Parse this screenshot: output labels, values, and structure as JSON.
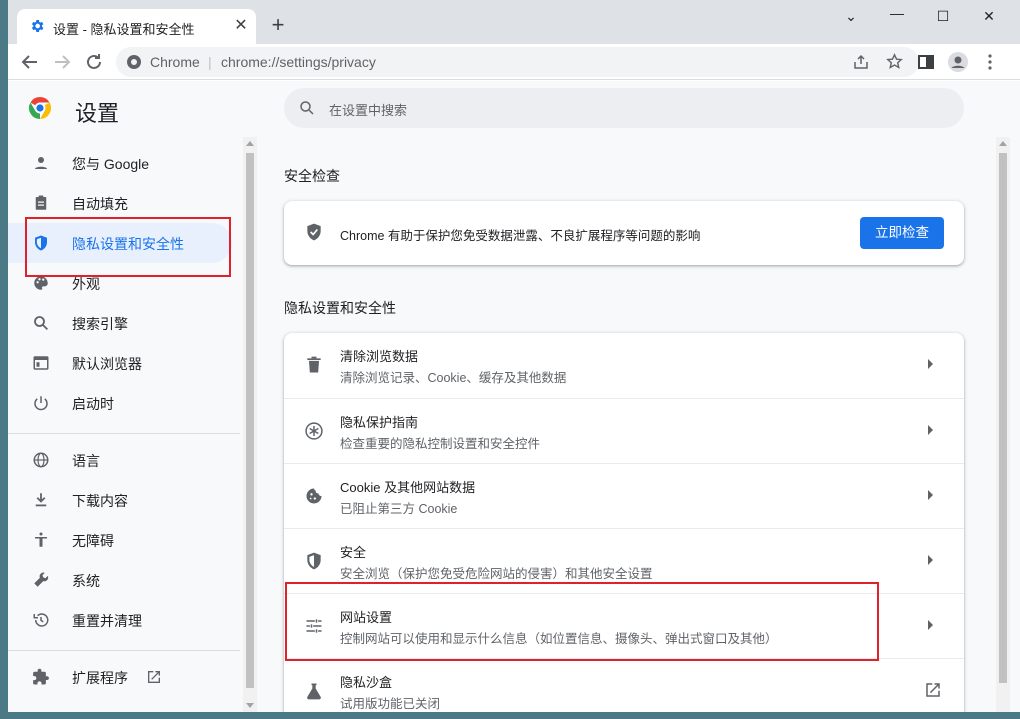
{
  "browser": {
    "tab_title": "设置 - 隐私设置和安全性",
    "tab_close": "✕",
    "new_tab": "+",
    "window_controls": {
      "menu": "⌄",
      "minimize": "—",
      "maximize": "☐",
      "close": "✕"
    },
    "site_label": "Chrome",
    "separator": "|",
    "url": "chrome://settings/privacy"
  },
  "settings": {
    "title": "设置",
    "search_placeholder": "在设置中搜索"
  },
  "sidebar": {
    "items": [
      {
        "label": "您与 Google",
        "icon": "person-icon"
      },
      {
        "label": "自动填充",
        "icon": "clipboard-icon"
      },
      {
        "label": "隐私设置和安全性",
        "icon": "shield-icon",
        "active": true
      },
      {
        "label": "外观",
        "icon": "palette-icon"
      },
      {
        "label": "搜索引擎",
        "icon": "search-icon"
      },
      {
        "label": "默认浏览器",
        "icon": "browser-icon"
      },
      {
        "label": "启动时",
        "icon": "power-icon"
      },
      {
        "label": "语言",
        "icon": "globe-icon"
      },
      {
        "label": "下载内容",
        "icon": "download-icon"
      },
      {
        "label": "无障碍",
        "icon": "accessibility-icon"
      },
      {
        "label": "系统",
        "icon": "wrench-icon"
      },
      {
        "label": "重置并清理",
        "icon": "history-icon"
      },
      {
        "label": "扩展程序",
        "icon": "puzzle-icon"
      }
    ]
  },
  "safety_check": {
    "title": "安全检查",
    "text": "Chrome 有助于保护您免受数据泄露、不良扩展程序等问题的影响",
    "button": "立即检查"
  },
  "privacy": {
    "title": "隐私设置和安全性",
    "rows": [
      {
        "title": "清除浏览数据",
        "subtitle": "清除浏览记录、Cookie、缓存及其他数据",
        "icon": "trash-icon"
      },
      {
        "title": "隐私保护指南",
        "subtitle": "检查重要的隐私控制设置和安全控件",
        "icon": "privacy-guide-icon"
      },
      {
        "title": "Cookie 及其他网站数据",
        "subtitle": "已阻止第三方 Cookie",
        "icon": "cookie-icon"
      },
      {
        "title": "安全",
        "subtitle": "安全浏览（保护您免受危险网站的侵害）和其他安全设置",
        "icon": "security-shield-icon"
      },
      {
        "title": "网站设置",
        "subtitle": "控制网站可以使用和显示什么信息（如位置信息、摄像头、弹出式窗口及其他）",
        "icon": "sliders-icon"
      },
      {
        "title": "隐私沙盒",
        "subtitle": "试用版功能已关闭",
        "icon": "flask-icon"
      }
    ]
  },
  "colors": {
    "accent": "#1a73e8",
    "highlight": "#e0202a",
    "active_bg": "#e8f0fe"
  }
}
